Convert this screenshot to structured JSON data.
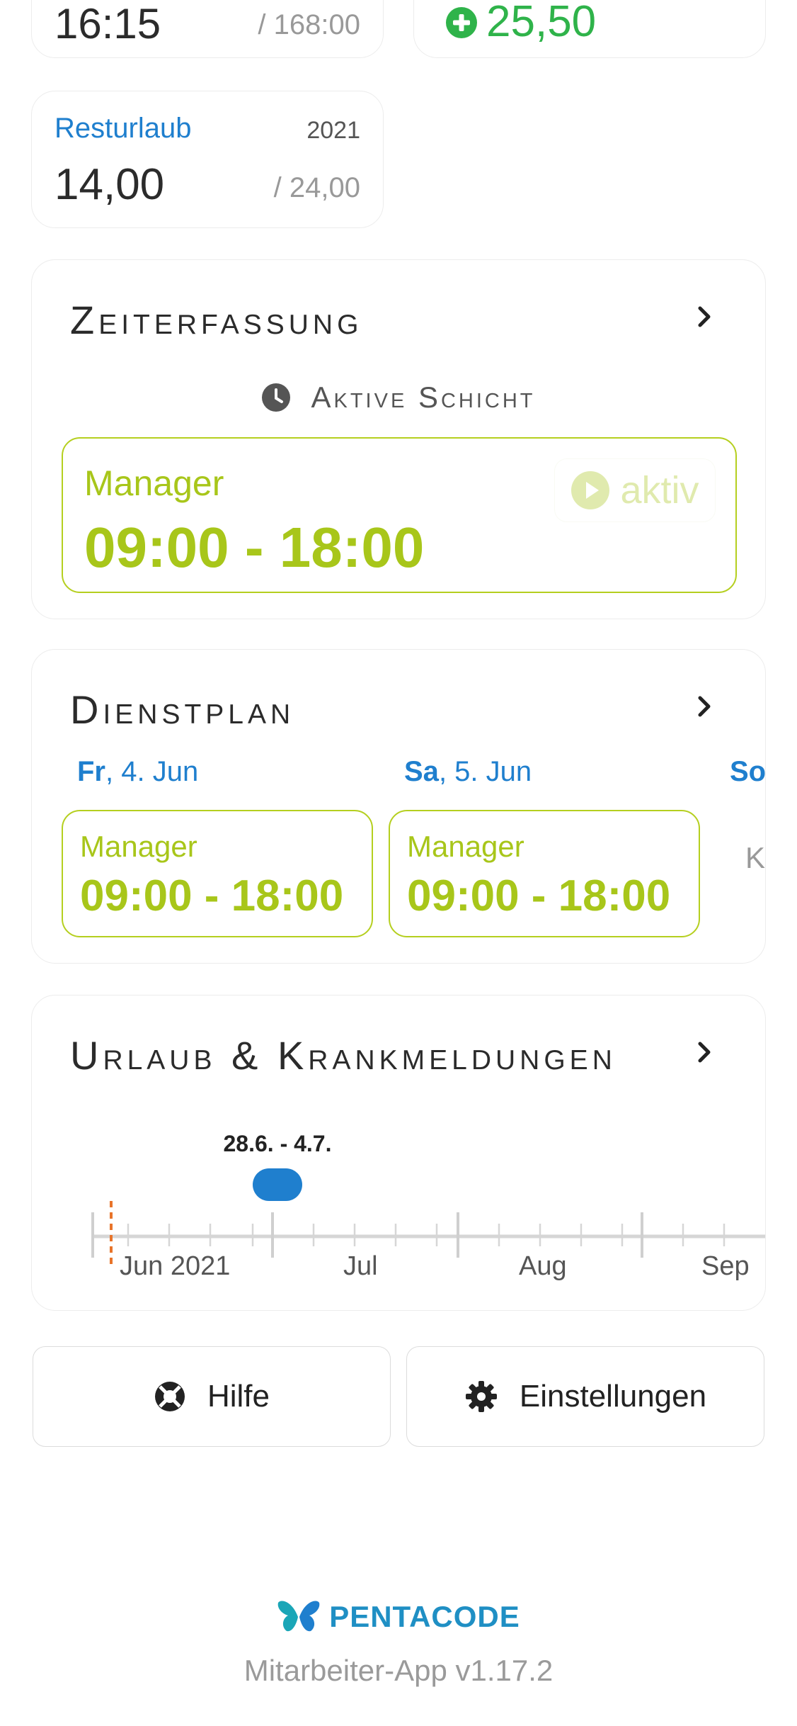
{
  "top_stats": {
    "hours_value": "16:15",
    "hours_total": "/ 168:00",
    "balance_value": "25,50"
  },
  "vacation": {
    "label": "Resturlaub",
    "year": "2021",
    "value": "14,00",
    "total": "/ 24,00"
  },
  "zeiterfassung": {
    "title": "Zeiterfassung",
    "active_label": "Aktive Schicht",
    "role": "Manager",
    "time": "09:00 - 18:00",
    "status": "aktiv"
  },
  "dienstplan": {
    "title": "Dienstplan",
    "days": [
      {
        "dow": "Fr",
        "date": ", 4. Jun",
        "role": "Manager",
        "time": "09:00 - 18:00"
      },
      {
        "dow": "Sa",
        "date": ", 5. Jun",
        "role": "Manager",
        "time": "09:00 - 18:00"
      },
      {
        "dow": "So",
        "date": "",
        "note": "K"
      }
    ]
  },
  "urlaub": {
    "title": "Urlaub & Krankmeldungen",
    "event_label": "28.6. - 4.7.",
    "months": [
      "Jun 2021",
      "Jul",
      "Aug",
      "Sep"
    ]
  },
  "buttons": {
    "help": "Hilfe",
    "settings": "Einstellungen"
  },
  "footer": {
    "brand": "PENTACODE",
    "version": "Mitarbeiter-App v1.17.2"
  },
  "colors": {
    "accent_blue": "#1f7fce",
    "accent_lime": "#a8c61a",
    "positive_green": "#2fb34a",
    "today_marker": "#e8742a"
  }
}
